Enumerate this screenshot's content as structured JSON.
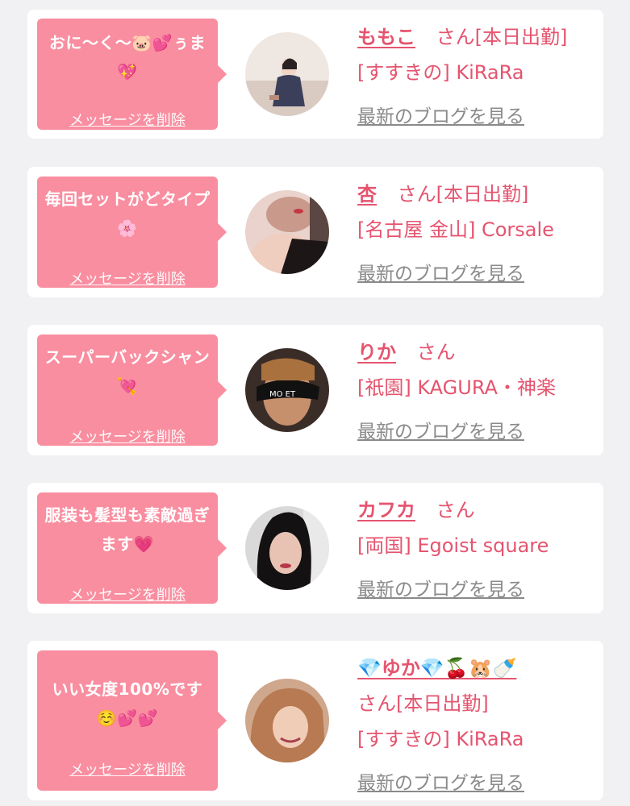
{
  "entries": [
    {
      "message": "おに〜く〜🐷💕ぅま💖",
      "delete_label": "メッセージを削除",
      "name": "ももこ",
      "honorific": "さん",
      "badge": "[本日出勤]",
      "area_shop": "[すすきの] KiRaRa",
      "blog_label": "最新のブログを見る"
    },
    {
      "message": "毎回セットがどタイプ🌸",
      "delete_label": "メッセージを削除",
      "name": "杏",
      "honorific": "さん",
      "badge": "[本日出勤]",
      "area_shop": "[名古屋 金山] Corsale",
      "blog_label": "最新のブログを見る"
    },
    {
      "message": "スーパーバックシャン💘",
      "delete_label": "メッセージを削除",
      "name": "りか",
      "honorific": "さん",
      "badge": "",
      "area_shop": "[祇園] KAGURA・神楽",
      "blog_label": "最新のブログを見る"
    },
    {
      "message": "服装も髪型も素敵過ぎます💗",
      "delete_label": "メッセージを削除",
      "name": "カフカ",
      "honorific": "さん",
      "badge": "",
      "area_shop": "[両国] Egoist square",
      "blog_label": "最新のブログを見る"
    },
    {
      "message": "いい女度100%です☺️💕💕",
      "delete_label": "メッセージを削除",
      "name": "💎ゆか💎🍒🐹🍼",
      "honorific": "さん",
      "badge": "[本日出勤]",
      "area_shop": "[すすきの] KiRaRa",
      "blog_label": "最新のブログを見る"
    }
  ],
  "colors": {
    "background": "#f1f1f4",
    "card": "#ffffff",
    "bubble": "#f98ea0",
    "accent": "#e5546f",
    "link_gray": "#8a8a8a"
  }
}
